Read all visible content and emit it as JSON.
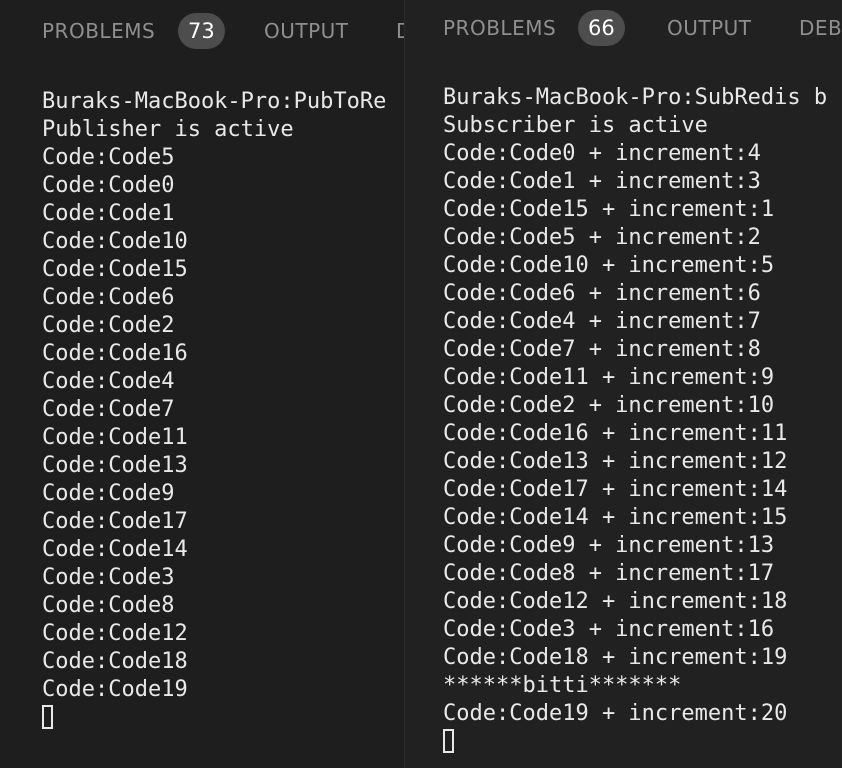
{
  "left_panel": {
    "tabs": {
      "problems": "PROBLEMS",
      "problems_count": "73",
      "output": "OUTPUT",
      "debug": "D"
    },
    "terminal_lines": [
      "Buraks-MacBook-Pro:PubToRe",
      "Publisher is active",
      "Code:Code5",
      "Code:Code0",
      "Code:Code1",
      "Code:Code10",
      "Code:Code15",
      "Code:Code6",
      "Code:Code2",
      "Code:Code16",
      "Code:Code4",
      "Code:Code7",
      "Code:Code11",
      "Code:Code13",
      "Code:Code9",
      "Code:Code17",
      "Code:Code14",
      "Code:Code3",
      "Code:Code8",
      "Code:Code12",
      "Code:Code18",
      "Code:Code19"
    ]
  },
  "right_panel": {
    "tabs": {
      "problems": "PROBLEMS",
      "problems_count": "66",
      "output": "OUTPUT",
      "debug": "DEB"
    },
    "terminal_lines": [
      "Buraks-MacBook-Pro:SubRedis b",
      "Subscriber is active",
      "Code:Code0 + increment:4",
      "Code:Code1 + increment:3",
      "Code:Code15 + increment:1",
      "Code:Code5 + increment:2",
      "Code:Code10 + increment:5",
      "Code:Code6 + increment:6",
      "Code:Code4 + increment:7",
      "Code:Code7 + increment:8",
      "Code:Code11 + increment:9",
      "Code:Code2 + increment:10",
      "Code:Code16 + increment:11",
      "Code:Code13 + increment:12",
      "Code:Code17 + increment:14",
      "Code:Code14 + increment:15",
      "Code:Code9 + increment:13",
      "Code:Code8 + increment:17",
      "Code:Code12 + increment:18",
      "Code:Code3 + increment:16",
      "Code:Code18 + increment:19",
      "******bitti*******",
      "Code:Code19 + increment:20"
    ]
  },
  "colors": {
    "background": "#1e1e1e",
    "tab_text": "#8f8f8f",
    "badge_bg": "#4d4d4d",
    "terminal_text": "#e8e8e8"
  }
}
